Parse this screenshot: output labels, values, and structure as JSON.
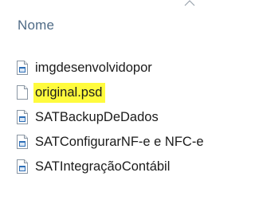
{
  "header": {
    "column_title": "Nome",
    "sort_icon": "chevron-up-icon"
  },
  "files": [
    {
      "name": "imgdesenvolvidopor",
      "icon": "executable-file-icon",
      "highlighted": false
    },
    {
      "name": "original.psd",
      "icon": "blank-file-icon",
      "highlighted": true
    },
    {
      "name": "SATBackupDeDados",
      "icon": "executable-file-icon",
      "highlighted": false
    },
    {
      "name": "SATConfigurarNF-e e NFC-e",
      "icon": "executable-file-icon",
      "highlighted": false
    },
    {
      "name": "SATIntegraçãoContábil",
      "icon": "executable-file-icon",
      "highlighted": false
    }
  ],
  "colors": {
    "header_text": "#4f6b86",
    "highlight": "#fffb3d",
    "file_text": "#1b1b1b"
  }
}
